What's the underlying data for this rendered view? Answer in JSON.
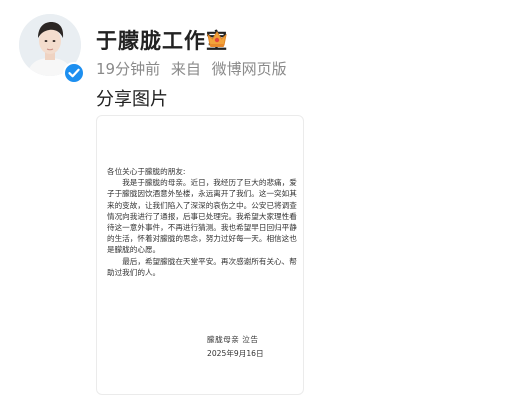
{
  "post": {
    "author_name": "于朦胧工作室",
    "time": "19分钟前",
    "source_prefix": "来自",
    "source": "微博网页版",
    "text": "分享图片"
  },
  "icons": {
    "avatar": "avatar-photo",
    "verified": "verified-badge-icon",
    "crown": "crown-icon"
  },
  "colors": {
    "verified_blue": "#1d8ff0",
    "meta_gray": "#8a8a8a",
    "crown_orange": "#f2a33a"
  },
  "letter": {
    "greeting": "各位关心于朦胧的朋友:",
    "paragraph1": "我是于朦胧的母亲。近日，我经历了巨大的悲痛，爱子于朦胧因饮酒意外坠楼，永远离开了我们。这一突如其来的变故，让我们陷入了深深的哀伤之中。公安已将调查情况向我进行了通报，后事已处理完。我希望大家理性看待这一意外事件，不再进行猜测。我也希望早日回归平静的生活，怀着对朦胧的思念，努力过好每一天。相信这也是朦胧的心愿。",
    "paragraph2": "最后，希望朦胧在天堂平安。再次感谢所有关心、帮助过我们的人。",
    "signature": "朦胧母亲  泣告",
    "date": "2025年9月16日"
  }
}
